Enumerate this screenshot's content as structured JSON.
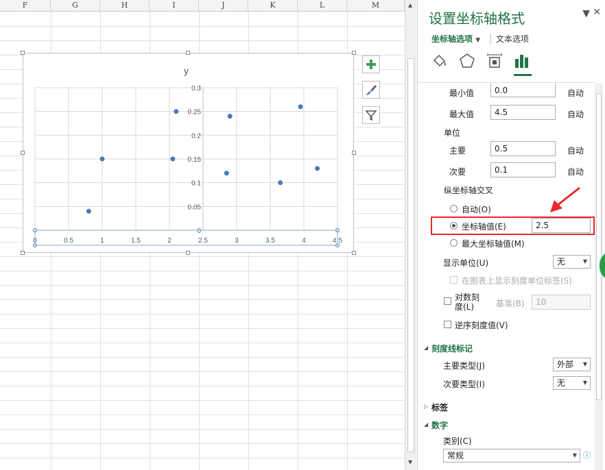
{
  "sheet": {
    "columns": [
      "F",
      "G",
      "H",
      "I",
      "J",
      "K",
      "L",
      "M"
    ]
  },
  "chart": {
    "tools": [
      "add-chart-element-icon",
      "chart-styles-icon",
      "chart-filter-icon"
    ]
  },
  "chart_data": {
    "type": "scatter",
    "title": "y",
    "xlim": [
      0,
      4.5
    ],
    "ylim": [
      0,
      0.3
    ],
    "x_ticks": [
      "0",
      "0.5",
      "1",
      "1.5",
      "2",
      "2.5",
      "3",
      "3.5",
      "4",
      "4.5"
    ],
    "y_ticks": [
      "0",
      "0.05",
      "0.1",
      "0.15",
      "0.2",
      "0.25",
      "0.3"
    ],
    "points": [
      {
        "x": 0.8,
        "y": 0.04
      },
      {
        "x": 1.0,
        "y": 0.15
      },
      {
        "x": 2.05,
        "y": 0.15
      },
      {
        "x": 2.1,
        "y": 0.25
      },
      {
        "x": 2.85,
        "y": 0.12
      },
      {
        "x": 2.9,
        "y": 0.24
      },
      {
        "x": 3.65,
        "y": 0.1
      },
      {
        "x": 3.95,
        "y": 0.26
      },
      {
        "x": 4.2,
        "y": 0.13
      }
    ],
    "y_axis_crosses_at": 2.5,
    "grid": true,
    "marker_color": "#4a7ab5"
  },
  "pane": {
    "title": "设置坐标轴格式",
    "tab_axis": "坐标轴选项",
    "tab_text": "文本选项",
    "min_label": "最小值",
    "min_value": "0.0",
    "max_label": "最大值",
    "max_value": "4.5",
    "auto": "自动",
    "unit_heading": "单位",
    "major_label": "主要",
    "major_value": "0.5",
    "minor_label": "次要",
    "minor_value": "0.1",
    "cross_heading": "纵坐标轴交叉",
    "cross_auto": "自动(O)",
    "cross_value_label": "坐标轴值(E)",
    "cross_value": "2.5",
    "cross_max": "最大坐标轴值(M)",
    "display_unit_label": "显示单位(U)",
    "display_unit_value": "无",
    "show_unit_label": "在图表上显示刻度单位标签(S)",
    "log_scale_label": "对数刻度(L)",
    "base_label": "基准(B)",
    "base_value": "10",
    "reverse_label": "逆序刻度值(V)",
    "tick_section": "刻度线标记",
    "major_type_label": "主要类型(J)",
    "major_type_value": "外部",
    "minor_type_label": "次要类型(I)",
    "minor_type_value": "无",
    "labels_section": "标签",
    "number_section": "数字",
    "category_label": "类别(C)",
    "category_value": "常规"
  },
  "colors": {
    "accent": "#217346",
    "highlight": "#e8282b",
    "marker": "#4a7ab5"
  }
}
